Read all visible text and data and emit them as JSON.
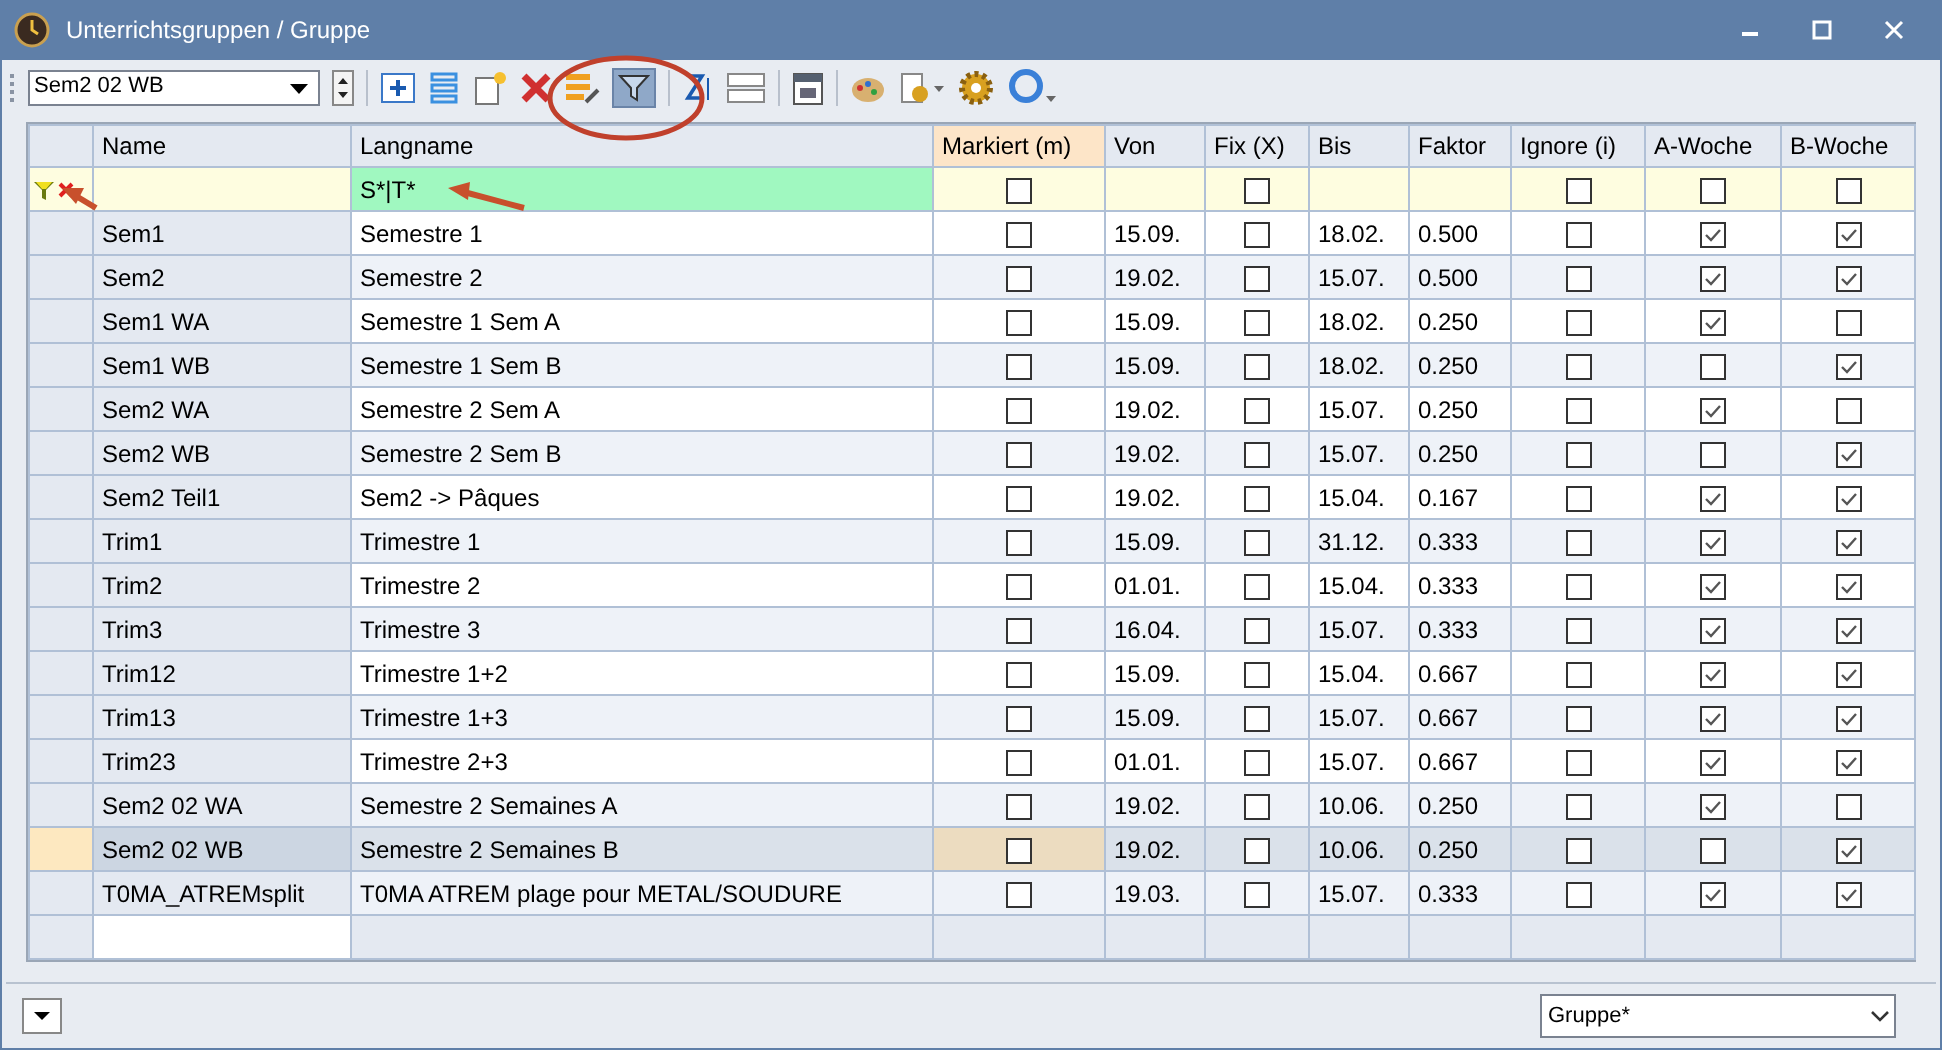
{
  "window": {
    "title": "Unterrichtsgruppen / Gruppe"
  },
  "toolbar": {
    "selector_value": "Sem2 02 WB",
    "filter_active": true
  },
  "table": {
    "columns": [
      "Name",
      "Langname",
      "Markiert (m)",
      "Von",
      "Fix (X)",
      "Bis",
      "Faktor",
      "Ignore (i)",
      "A-Woche",
      "B-Woche"
    ],
    "filter_row": {
      "langname": "S*|T*",
      "markiert": false,
      "fix": false,
      "ignore": false,
      "a_woche": false,
      "b_woche": false
    },
    "rows": [
      {
        "name": "Sem1",
        "langname": "Semestre 1",
        "markiert": false,
        "von": "15.09.",
        "fix": false,
        "bis": "18.02.",
        "faktor": "0.500",
        "ignore": false,
        "a_woche": true,
        "b_woche": true,
        "selected": false
      },
      {
        "name": "Sem2",
        "langname": "Semestre 2",
        "markiert": false,
        "von": "19.02.",
        "fix": false,
        "bis": "15.07.",
        "faktor": "0.500",
        "ignore": false,
        "a_woche": true,
        "b_woche": true,
        "selected": false
      },
      {
        "name": "Sem1 WA",
        "langname": "Semestre 1 Sem A",
        "markiert": false,
        "von": "15.09.",
        "fix": false,
        "bis": "18.02.",
        "faktor": "0.250",
        "ignore": false,
        "a_woche": true,
        "b_woche": false,
        "selected": false
      },
      {
        "name": "Sem1 WB",
        "langname": "Semestre 1 Sem B",
        "markiert": false,
        "von": "15.09.",
        "fix": false,
        "bis": "18.02.",
        "faktor": "0.250",
        "ignore": false,
        "a_woche": false,
        "b_woche": true,
        "selected": false
      },
      {
        "name": "Sem2 WA",
        "langname": "Semestre 2 Sem A",
        "markiert": false,
        "von": "19.02.",
        "fix": false,
        "bis": "15.07.",
        "faktor": "0.250",
        "ignore": false,
        "a_woche": true,
        "b_woche": false,
        "selected": false
      },
      {
        "name": "Sem2 WB",
        "langname": "Semestre 2 Sem B",
        "markiert": false,
        "von": "19.02.",
        "fix": false,
        "bis": "15.07.",
        "faktor": "0.250",
        "ignore": false,
        "a_woche": false,
        "b_woche": true,
        "selected": false
      },
      {
        "name": "Sem2 Teil1",
        "langname": "Sem2 -> Pâques",
        "markiert": false,
        "von": "19.02.",
        "fix": false,
        "bis": "15.04.",
        "faktor": "0.167",
        "ignore": false,
        "a_woche": true,
        "b_woche": true,
        "selected": false
      },
      {
        "name": "Trim1",
        "langname": "Trimestre 1",
        "markiert": false,
        "von": "15.09.",
        "fix": false,
        "bis": "31.12.",
        "faktor": "0.333",
        "ignore": false,
        "a_woche": true,
        "b_woche": true,
        "selected": false
      },
      {
        "name": "Trim2",
        "langname": "Trimestre 2",
        "markiert": false,
        "von": "01.01.",
        "fix": false,
        "bis": "15.04.",
        "faktor": "0.333",
        "ignore": false,
        "a_woche": true,
        "b_woche": true,
        "selected": false
      },
      {
        "name": "Trim3",
        "langname": "Trimestre 3",
        "markiert": false,
        "von": "16.04.",
        "fix": false,
        "bis": "15.07.",
        "faktor": "0.333",
        "ignore": false,
        "a_woche": true,
        "b_woche": true,
        "selected": false
      },
      {
        "name": "Trim12",
        "langname": "Trimestre 1+2",
        "markiert": false,
        "von": "15.09.",
        "fix": false,
        "bis": "15.04.",
        "faktor": "0.667",
        "ignore": false,
        "a_woche": true,
        "b_woche": true,
        "selected": false
      },
      {
        "name": "Trim13",
        "langname": "Trimestre 1+3",
        "markiert": false,
        "von": "15.09.",
        "fix": false,
        "bis": "15.07.",
        "faktor": "0.667",
        "ignore": false,
        "a_woche": true,
        "b_woche": true,
        "selected": false
      },
      {
        "name": "Trim23",
        "langname": "Trimestre 2+3",
        "markiert": false,
        "von": "01.01.",
        "fix": false,
        "bis": "15.07.",
        "faktor": "0.667",
        "ignore": false,
        "a_woche": true,
        "b_woche": true,
        "selected": false
      },
      {
        "name": "Sem2 02 WA",
        "langname": "Semestre 2 Semaines A",
        "markiert": false,
        "von": "19.02.",
        "fix": false,
        "bis": "10.06.",
        "faktor": "0.250",
        "ignore": false,
        "a_woche": true,
        "b_woche": false,
        "selected": false
      },
      {
        "name": "Sem2 02 WB",
        "langname": "Semestre 2 Semaines B",
        "markiert": false,
        "von": "19.02.",
        "fix": false,
        "bis": "10.06.",
        "faktor": "0.250",
        "ignore": false,
        "a_woche": false,
        "b_woche": true,
        "selected": true
      },
      {
        "name": "T0MA_ATREMsplit",
        "langname": "T0MA ATREM plage pour METAL/SOUDURE",
        "markiert": false,
        "von": "19.03.",
        "fix": false,
        "bis": "15.07.",
        "faktor": "0.333",
        "ignore": false,
        "a_woche": true,
        "b_woche": true,
        "selected": false
      }
    ]
  },
  "footer": {
    "view_selector": "Gruppe*"
  }
}
